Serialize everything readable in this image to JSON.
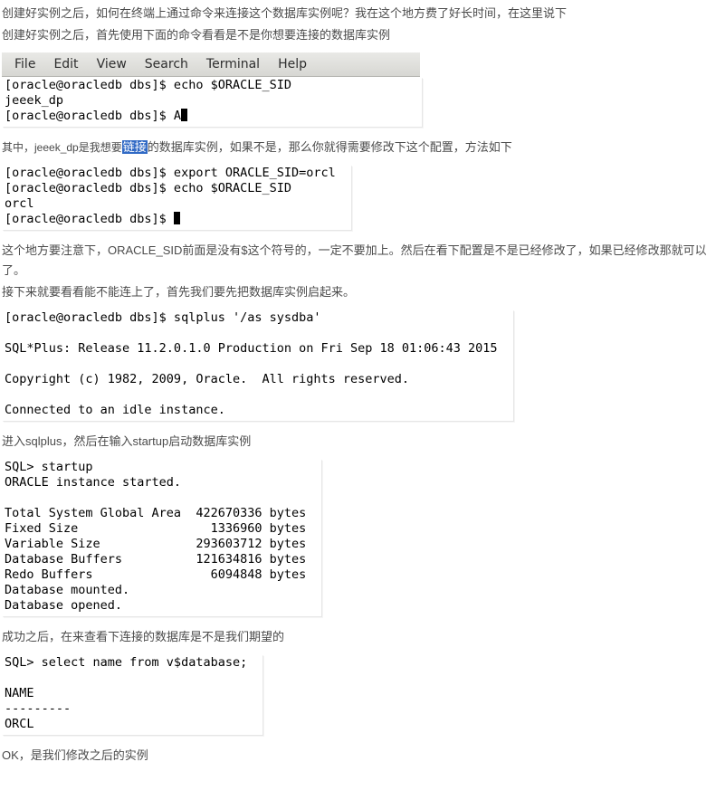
{
  "p1": "创建好实例之后，如何在终端上通过命令来连接这个数据库实例呢？我在这个地方费了好长时间，在这里说下",
  "p2": "创建好实例之后，首先使用下面的命令看看是不是你想要连接的数据库实例",
  "menu": {
    "file": "File",
    "edit": "Edit",
    "view": "View",
    "search": "Search",
    "terminal": "Terminal",
    "help": "Help"
  },
  "term1_l1": "[oracle@oracledb dbs]$ echo $ORACLE_SID",
  "term1_l2": "jeeek_dp",
  "term1_l3": "[oracle@oracledb dbs]$ A",
  "p3a": "其中，jeeek_dp是我想要",
  "p3_hl": "链接",
  "p3b": "的数据库实例，如果不是，那么你就得需要修改下这个配置，方法如下",
  "term2_l1": "[oracle@oracledb dbs]$ export ORACLE_SID=orcl",
  "term2_l2": "[oracle@oracledb dbs]$ echo $ORACLE_SID",
  "term2_l3": "orcl",
  "term2_l4": "[oracle@oracledb dbs]$ ",
  "p4": "这个地方要注意下，ORACLE_SID前面是没有$这个符号的，一定不要加上。然后在看下配置是不是已经修改了，如果已经修改那就可以了。",
  "p5": "接下来就要看看能不能连上了，首先我们要先把数据库实例启起来。",
  "term3_l1": "[oracle@oracledb dbs]$ sqlplus '/as sysdba'",
  "term3_l2": "SQL*Plus: Release 11.2.0.1.0 Production on Fri Sep 18 01:06:43 2015",
  "term3_l3": "Copyright (c) 1982, 2009, Oracle.  All rights reserved.",
  "term3_l4": "Connected to an idle instance.",
  "p6": "进入sqlplus，然后在输入startup启动数据库实例",
  "term4_l1": "SQL> startup",
  "term4_l2": "ORACLE instance started.",
  "term4_l3": "Total System Global Area  422670336 bytes",
  "term4_l4": "Fixed Size                  1336960 bytes",
  "term4_l5": "Variable Size             293603712 bytes",
  "term4_l6": "Database Buffers          121634816 bytes",
  "term4_l7": "Redo Buffers                6094848 bytes",
  "term4_l8": "Database mounted.",
  "term4_l9": "Database opened.",
  "p7": "成功之后，在来查看下连接的数据库是不是我们期望的",
  "term5_l1": "SQL> select name from v$database;",
  "term5_l2": "NAME",
  "term5_l3": "---------",
  "term5_l4": "ORCL",
  "p8": "OK，是我们修改之后的实例"
}
